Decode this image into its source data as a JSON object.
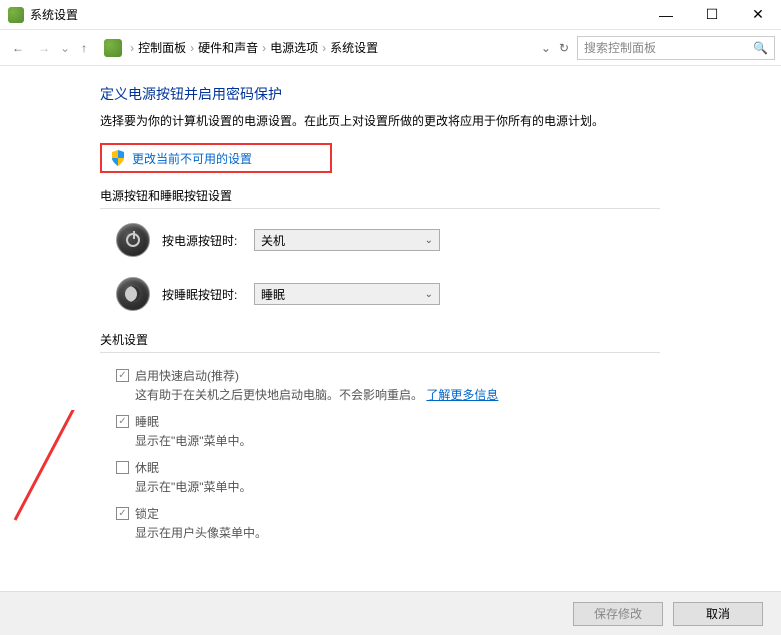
{
  "window": {
    "title": "系统设置"
  },
  "breadcrumbs": [
    "控制面板",
    "硬件和声音",
    "电源选项",
    "系统设置"
  ],
  "search": {
    "placeholder": "搜索控制面板"
  },
  "main": {
    "heading": "定义电源按钮并启用密码保护",
    "subtext": "选择要为你的计算机设置的电源设置。在此页上对设置所做的更改将应用于你所有的电源计划。",
    "change_link": "更改当前不可用的设置"
  },
  "buttons_section": {
    "title": "电源按钮和睡眠按钮设置",
    "power_label": "按电源按钮时:",
    "power_value": "关机",
    "sleep_label": "按睡眠按钮时:",
    "sleep_value": "睡眠"
  },
  "shutdown_section": {
    "title": "关机设置",
    "items": [
      {
        "label": "启用快速启动(推荐)",
        "checked": true,
        "desc_prefix": "这有助于在关机之后更快地启动电脑。不会影响重启。",
        "desc_link": "了解更多信息"
      },
      {
        "label": "睡眠",
        "checked": true,
        "desc": "显示在\"电源\"菜单中。"
      },
      {
        "label": "休眠",
        "checked": false,
        "desc": "显示在\"电源\"菜单中。"
      },
      {
        "label": "锁定",
        "checked": true,
        "desc": "显示在用户头像菜单中。"
      }
    ]
  },
  "footer": {
    "save": "保存修改",
    "cancel": "取消"
  }
}
